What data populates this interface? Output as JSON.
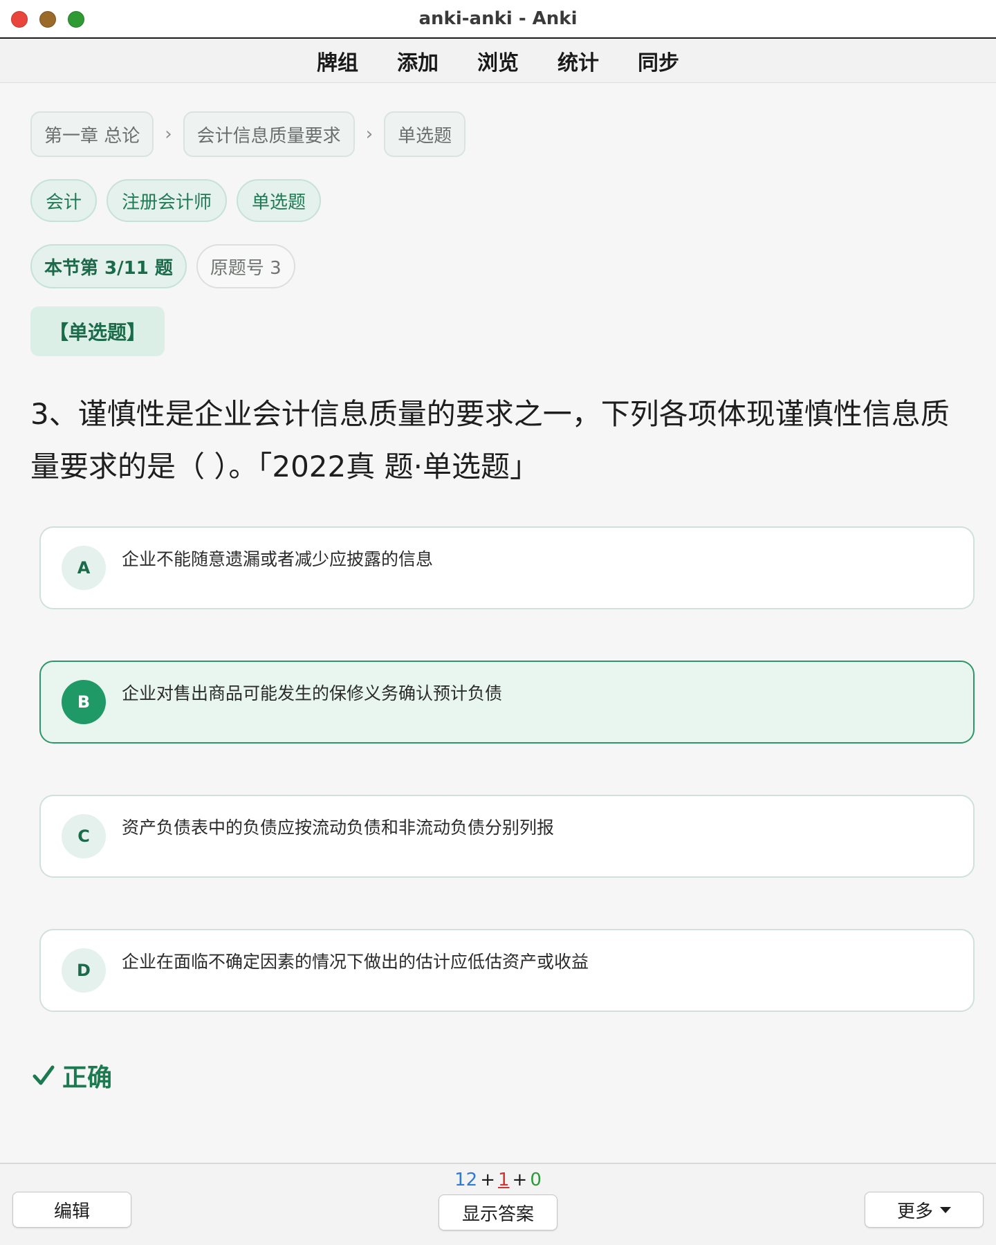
{
  "window": {
    "title": "anki-anki - Anki"
  },
  "toolbar": {
    "items": [
      "牌组",
      "添加",
      "浏览",
      "统计",
      "同步"
    ]
  },
  "breadcrumb": {
    "items": [
      "第一章 总论",
      "会计信息质量要求",
      "单选题"
    ],
    "separator": "›"
  },
  "tags": [
    "会计",
    "注册会计师",
    "单选题"
  ],
  "progress": {
    "position": "本节第 3/11 题",
    "original": "原题号 3"
  },
  "question": {
    "type_label": "【单选题】",
    "text": "3、谨慎性是企业会计信息质量的要求之一，下列各项体现谨慎性信息质量要求的是（ ）。「2022真 题·单选题」"
  },
  "options": [
    {
      "letter": "A",
      "text": "企业不能随意遗漏或者减少应披露的信息",
      "selected": false
    },
    {
      "letter": "B",
      "text": "企业对售出商品可能发生的保修义务确认预计负债",
      "selected": true
    },
    {
      "letter": "C",
      "text": "资产负债表中的负债应按流动负债和非流动负债分别列报",
      "selected": false
    },
    {
      "letter": "D",
      "text": "企业在面临不确定因素的情况下做出的估计应低估资产或收益",
      "selected": false
    }
  ],
  "result": {
    "label": "正确",
    "icon": "check-icon"
  },
  "bottom": {
    "counts": {
      "new": "12",
      "learning": "1",
      "review": "0",
      "plus": "+"
    },
    "edit_label": "编辑",
    "show_answer_label": "显示答案",
    "more_label": "更多"
  },
  "colors": {
    "accent": "#1b6a4a",
    "selected_border": "#2d9767",
    "count_new": "#2f7ad8",
    "count_learning": "#d93030",
    "count_review": "#2c9a3a"
  }
}
